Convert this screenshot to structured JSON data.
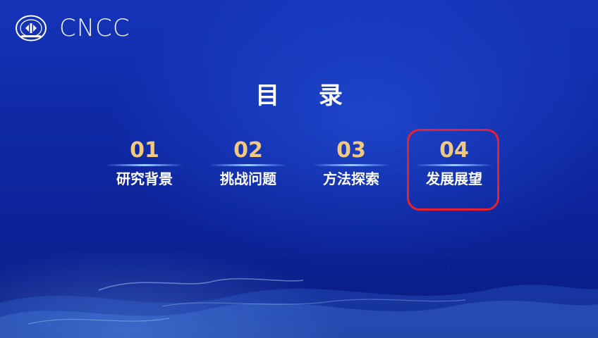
{
  "header": {
    "brand": "CNCC",
    "seal_icon": "ccf-seal-icon"
  },
  "slide": {
    "title": "目 录"
  },
  "toc": {
    "items": [
      {
        "num": "01",
        "label": "研究背景"
      },
      {
        "num": "02",
        "label": "挑战问题"
      },
      {
        "num": "03",
        "label": "方法探索"
      },
      {
        "num": "04",
        "label": "发展展望"
      }
    ],
    "highlighted_index": 3,
    "highlight_color": "#e8202f"
  },
  "colors": {
    "background": "#102aa6",
    "number": "#f2c97c",
    "text": "#ffffff"
  }
}
